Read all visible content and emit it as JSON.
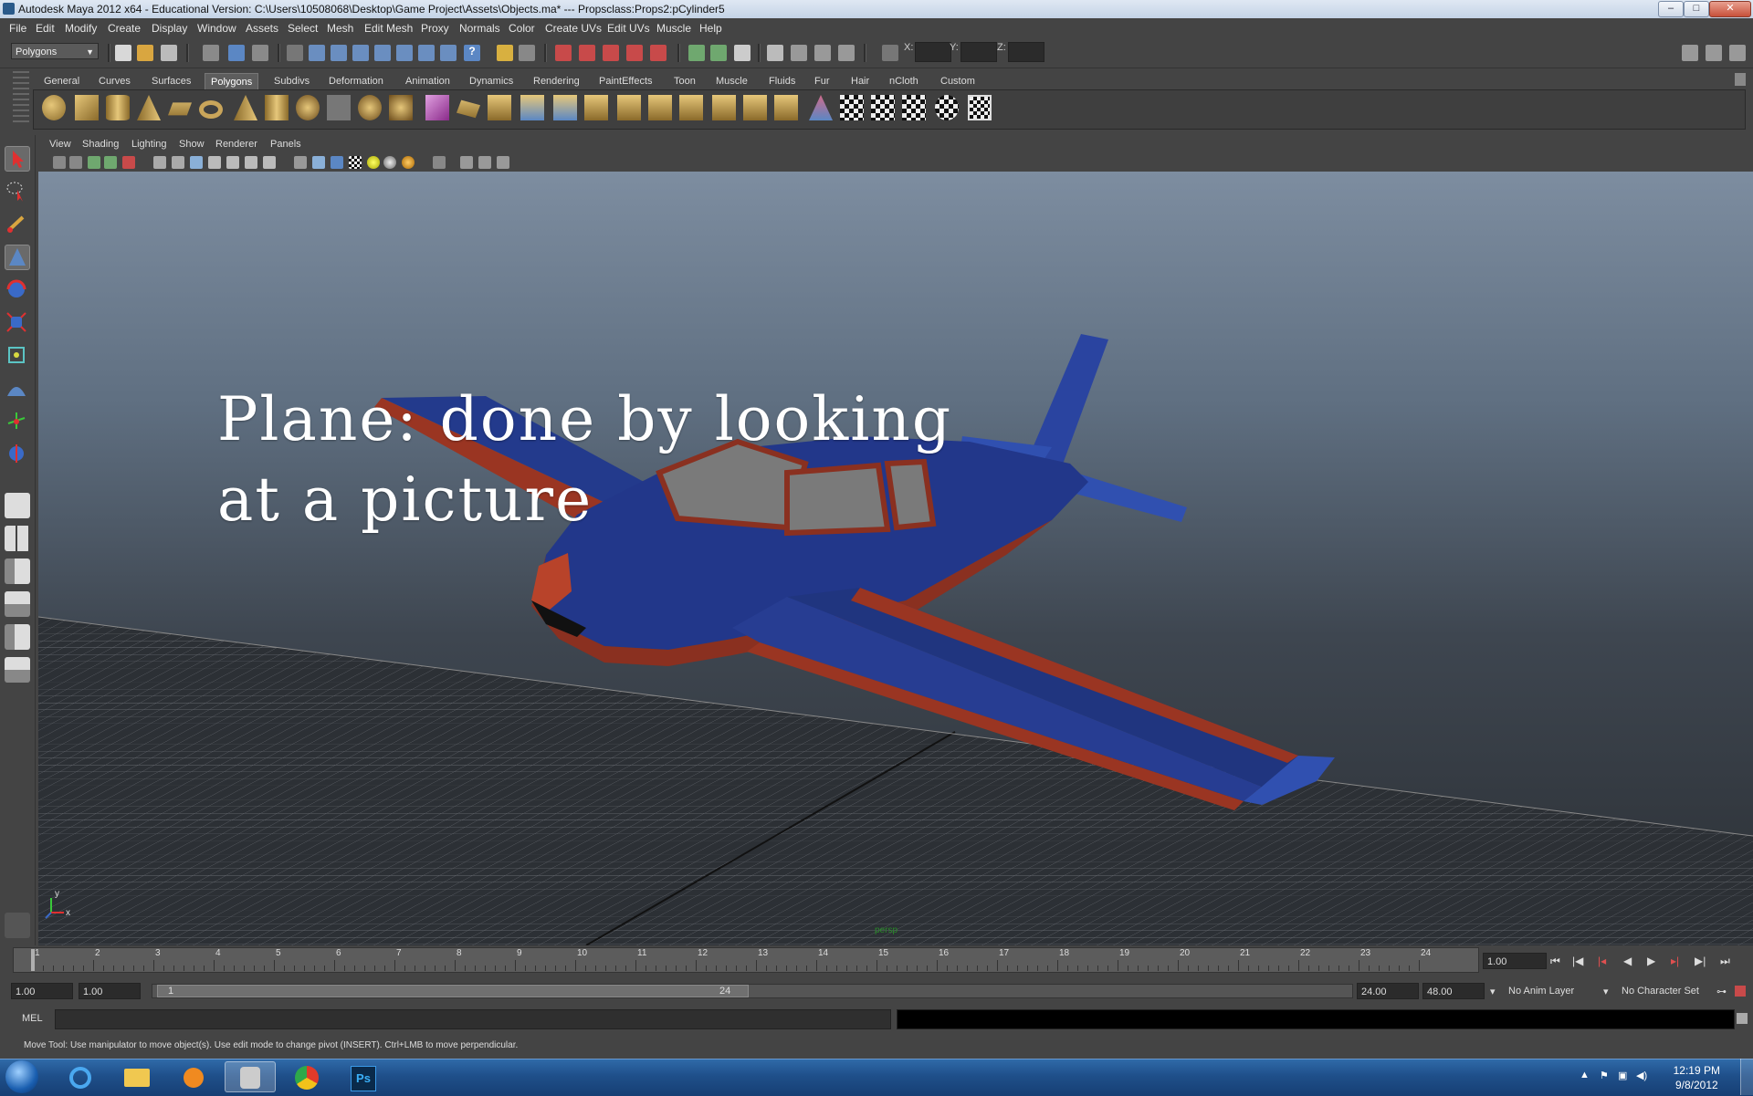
{
  "titlebar": {
    "title": "Autodesk Maya 2012 x64 - Educational Version: C:\\Users\\10508068\\Desktop\\Game Project\\Assets\\Objects.ma*   ---   Propsclass:Props2:pCylinder5"
  },
  "menubar": [
    "File",
    "Edit",
    "Modify",
    "Create",
    "Display",
    "Window",
    "Assets",
    "Select",
    "Mesh",
    "Edit Mesh",
    "Proxy",
    "Normals",
    "Color",
    "Create UVs",
    "Edit UVs",
    "Muscle",
    "Help"
  ],
  "statusline": {
    "mode": "Polygons",
    "x_label": "X:",
    "y_label": "Y:",
    "z_label": "Z:"
  },
  "shelf": {
    "tabs": [
      "General",
      "Curves",
      "Surfaces",
      "Polygons",
      "Subdivs",
      "Deformation",
      "Animation",
      "Dynamics",
      "Rendering",
      "PaintEffects",
      "Toon",
      "Muscle",
      "Fluids",
      "Fur",
      "Hair",
      "nCloth",
      "Custom"
    ],
    "active_tab": "Polygons"
  },
  "panel": {
    "menus": [
      "View",
      "Shading",
      "Lighting",
      "Show",
      "Renderer",
      "Panels"
    ]
  },
  "viewport": {
    "overlay_text": "Plane: done by looking\nat a picture",
    "axis_y": "y",
    "axis_x": "x",
    "camera_label": "persp"
  },
  "timeslider": {
    "ticks": [
      "1",
      "2",
      "3",
      "4",
      "5",
      "6",
      "7",
      "8",
      "9",
      "10",
      "11",
      "12",
      "13",
      "14",
      "15",
      "16",
      "17",
      "18",
      "19",
      "20",
      "21",
      "22",
      "23",
      "24"
    ],
    "current_frame": "1.00"
  },
  "range": {
    "start": "1.00",
    "playback_start": "1.00",
    "slider_start": "1",
    "slider_end": "24",
    "playback_end": "24.00",
    "end": "48.00",
    "anim_layer": "No Anim Layer",
    "character_set": "No Character Set"
  },
  "command": {
    "label": "MEL"
  },
  "help": {
    "text": "Move Tool: Use manipulator to move object(s). Use edit mode to change pivot (INSERT).  Ctrl+LMB to move perpendicular."
  },
  "taskbar": {
    "time": "12:19 PM",
    "date": "9/8/2012"
  },
  "colors": {
    "plane_body": "#233a8c",
    "plane_trim": "#9a3522",
    "viewport_top": "#7d8da0",
    "grid": "#6a6e74"
  }
}
